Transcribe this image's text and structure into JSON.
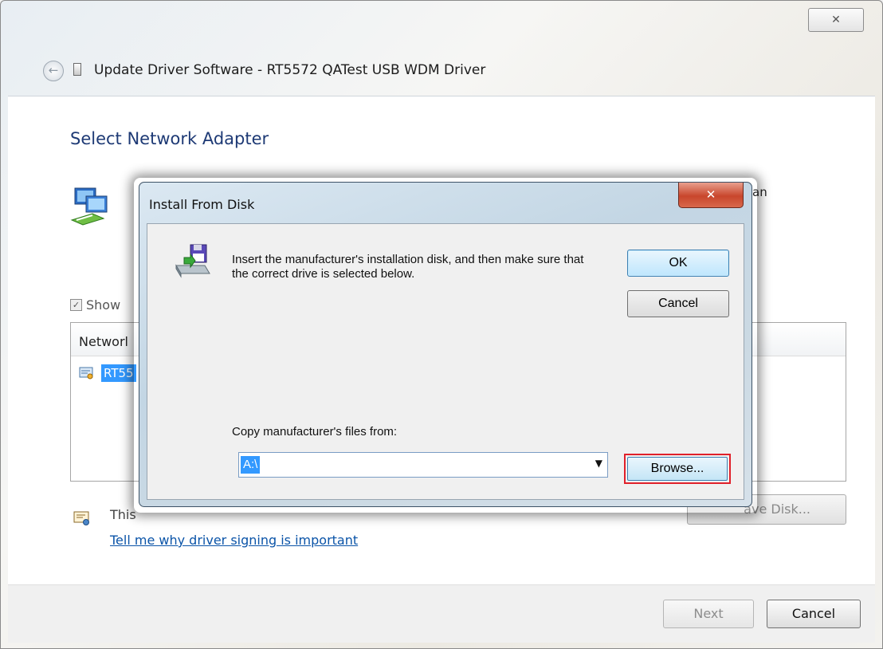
{
  "window": {
    "close_glyph": "✕",
    "back_glyph": "←",
    "title": "Update Driver Software - RT5572 QATest USB WDM Driver"
  },
  "page": {
    "heading": "Select Network Adapter",
    "obscured_right_fragment": "an",
    "show_compatible_label": "Show",
    "checkbox_glyph": "✓",
    "list_header": "Networl",
    "list_item": "RT55",
    "signature_text": "This",
    "signing_link": "Tell me why driver signing is important",
    "have_disk_label": "ave Disk...",
    "next_label": "Next",
    "cancel_label": "Cancel"
  },
  "dialog": {
    "title": "Install From Disk",
    "close_glyph": "✕",
    "message": "Insert the manufacturer's installation disk, and then make sure that the correct drive is selected below.",
    "ok_label": "OK",
    "cancel_label": "Cancel",
    "copy_label": "Copy manufacturer's files from:",
    "path_value": "A:\\",
    "combo_arrow": "▼",
    "browse_label": "Browse..."
  },
  "colors": {
    "heading": "#1e3a75",
    "selection": "#3399ff",
    "link": "#0b54a8",
    "highlight_border": "#e0202a",
    "close_red": "#c8462c"
  }
}
